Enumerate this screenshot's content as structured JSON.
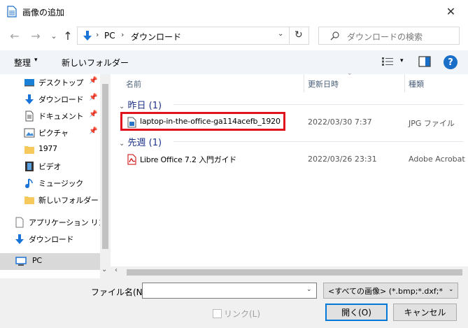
{
  "window": {
    "title": "画像の追加",
    "close_glyph": "✕"
  },
  "nav": {
    "back_glyph": "←",
    "forward_glyph": "→",
    "recent_glyph": "⌄",
    "up_glyph": "↑",
    "breadcrumb_sep": "›",
    "breadcrumb": [
      "PC",
      "ダウンロード"
    ],
    "dropdown_glyph": "⌄",
    "refresh_glyph": "↻",
    "search_placeholder": "ダウンロードの検索"
  },
  "toolbar": {
    "organize": "整理",
    "caret": "▾",
    "new_folder": "新しいフォルダー",
    "help": "?"
  },
  "sidebar": {
    "pin_glyph": "📌",
    "items": [
      {
        "label": "デスクトップ",
        "icon": "desktop-icon",
        "pinned": true
      },
      {
        "label": "ダウンロード",
        "icon": "download-icon",
        "pinned": true
      },
      {
        "label": "ドキュメント",
        "icon": "document-icon",
        "pinned": true
      },
      {
        "label": "ピクチャ",
        "icon": "picture-icon",
        "pinned": true
      },
      {
        "label": "1977",
        "icon": "folder-icon",
        "pinned": false
      },
      {
        "label": "ビデオ",
        "icon": "video-icon",
        "pinned": false
      },
      {
        "label": "ミュージック",
        "icon": "music-icon",
        "pinned": false
      },
      {
        "label": "新しいフォルダー",
        "icon": "folder-icon",
        "pinned": false
      },
      {
        "label": "アプリケーション リンク",
        "icon": "app-link-icon",
        "pinned": false
      },
      {
        "label": "ダウンロード",
        "icon": "download-icon",
        "pinned": false
      },
      {
        "label": "PC",
        "icon": "pc-icon",
        "pinned": false
      }
    ]
  },
  "columns": {
    "name": "名前",
    "date": "更新日時",
    "type": "種類"
  },
  "groups": [
    {
      "label": "昨日 (1)",
      "files": [
        {
          "name": "laptop-in-the-office-ga114acefb_1920",
          "date": "2022/03/30 7:37",
          "type": "JPG ファイル",
          "icon": "jpg-file-icon"
        }
      ]
    },
    {
      "label": "先週 (1)",
      "files": [
        {
          "name": "Libre Office 7.2 入門ガイド",
          "date": "2022/03/26 23:31",
          "type": "Adobe Acrobat D",
          "icon": "pdf-file-icon"
        }
      ]
    }
  ],
  "bottom": {
    "filename_label": "ファイル名(N):",
    "filename_value": "",
    "filter": "<すべての画像> (*.bmp;*.dxf;*.emf",
    "link_label": "リンク(L)",
    "open": "開く(O)",
    "cancel": "キャンセル"
  },
  "colors": {
    "accent": "#0078d7",
    "highlight_border": "#e0141e",
    "group_header": "#1e3287"
  }
}
